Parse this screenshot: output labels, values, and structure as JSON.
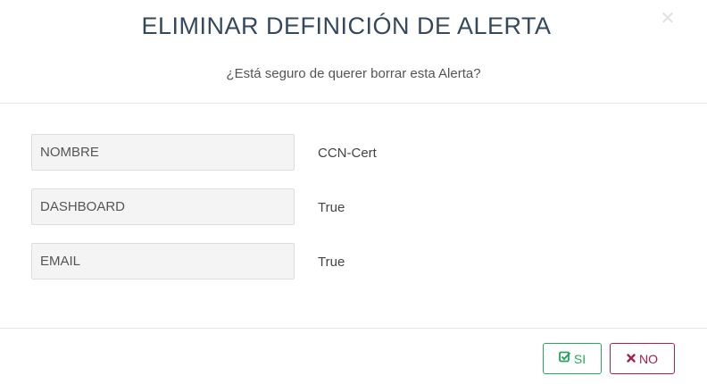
{
  "dialog": {
    "title": "ELIMINAR DEFINICIÓN DE ALERTA",
    "close_icon": "close-icon",
    "subtitle": "¿Está seguro de querer borrar esta Alerta?"
  },
  "fields": [
    {
      "label": "NOMBRE",
      "value": "CCN-Cert"
    },
    {
      "label": "DASHBOARD",
      "value": "True"
    },
    {
      "label": "EMAIL",
      "value": "True"
    }
  ],
  "footer": {
    "yes_label": "SI",
    "yes_icon": "checked-box-icon",
    "yes_color": "#26a65b",
    "no_label": "NO",
    "no_icon": "x-icon",
    "no_color": "#a5224a"
  }
}
